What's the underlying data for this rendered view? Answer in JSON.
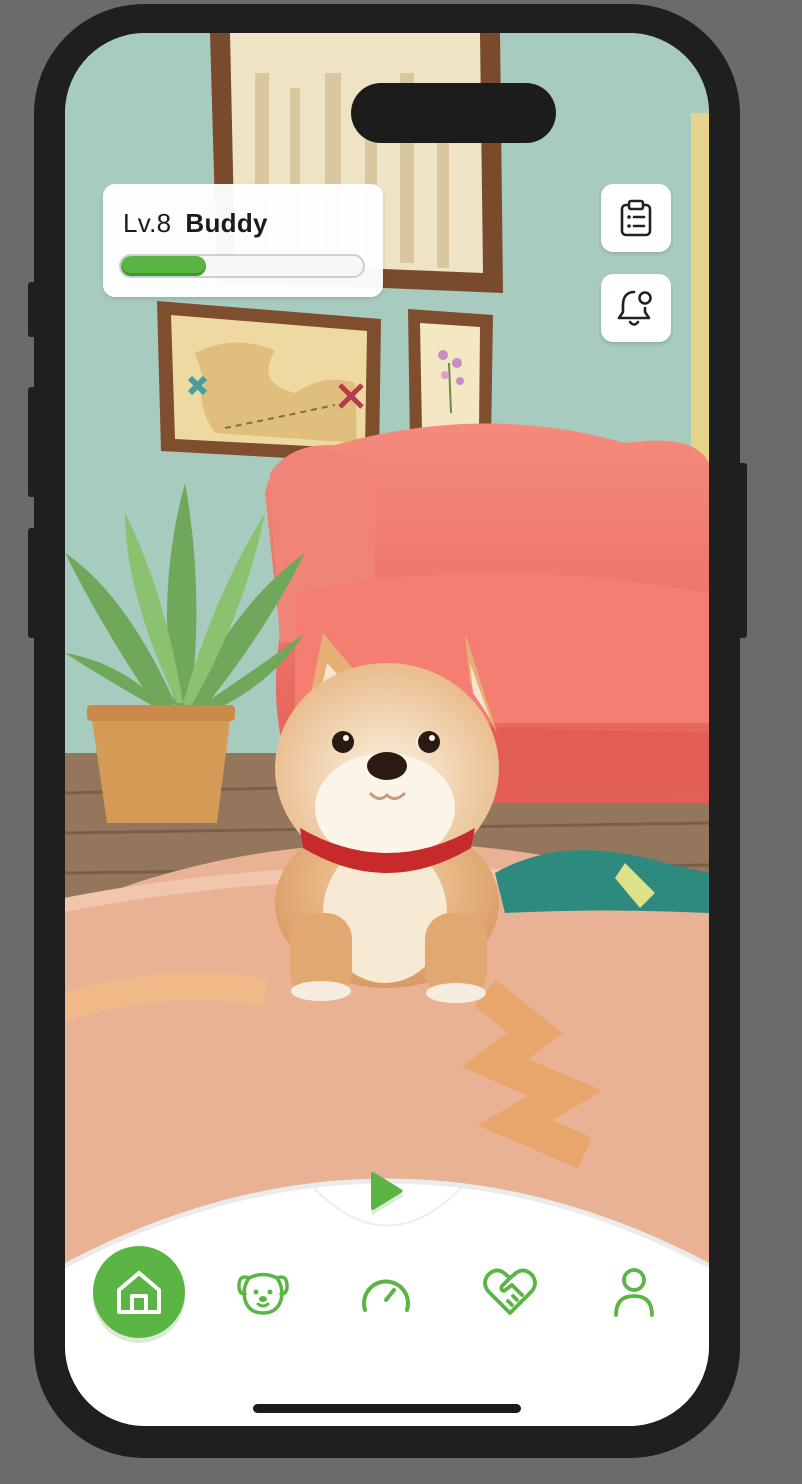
{
  "pet": {
    "level_label": "Lv.8",
    "name": "Buddy",
    "xp_progress": 0.35
  },
  "side_buttons": [
    {
      "icon": "clipboard-list-icon"
    },
    {
      "icon": "bell-settings-icon"
    }
  ],
  "play": {
    "icon": "play-icon"
  },
  "nav": {
    "active": "home",
    "items": [
      {
        "id": "home",
        "icon": "home-icon"
      },
      {
        "id": "pet",
        "icon": "dog-face-icon"
      },
      {
        "id": "stats",
        "icon": "gauge-icon"
      },
      {
        "id": "care",
        "icon": "heart-handshake-icon"
      },
      {
        "id": "profile",
        "icon": "user-icon"
      }
    ]
  },
  "colors": {
    "accent": "#5bb544",
    "accent_light": "#d9ecd3",
    "wall": "#a8cbbf",
    "rug": "#e9b295",
    "armchair": "#ee6d61",
    "phone_frame": "#1f1f1f",
    "backdrop": "#6b6b6b"
  }
}
